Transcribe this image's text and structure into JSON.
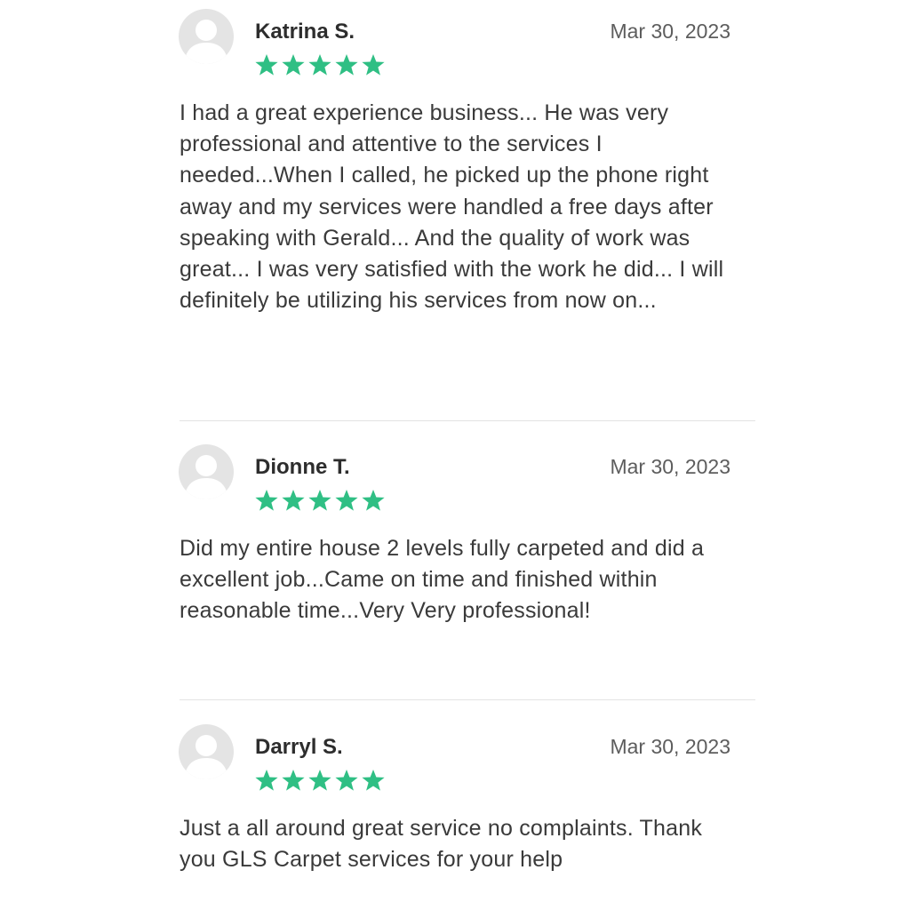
{
  "colors": {
    "star": "#2fbf84",
    "avatar_bg": "#e4e4e4",
    "avatar_fg": "#ffffff",
    "divider": "#e3e3e3"
  },
  "reviews": [
    {
      "name": "Katrina S.",
      "date": "Mar 30, 2023",
      "rating": 5,
      "avatar_icon": "person-placeholder-icon",
      "text": "I had a great experience business... He was very professional and attentive to the services I needed...When I called, he picked up the phone right away and my services were handled a free days after speaking with Gerald... And the quality of work was great... I was very satisfied with the work he did... I will definitely be utilizing his services from now on..."
    },
    {
      "name": "Dionne T.",
      "date": "Mar 30, 2023",
      "rating": 5,
      "avatar_icon": "person-placeholder-icon",
      "text": "Did my entire house 2 levels fully carpeted and did a excellent job...Came on time and finished within reasonable time...Very Very professional!"
    },
    {
      "name": "Darryl S.",
      "date": "Mar 30, 2023",
      "rating": 5,
      "avatar_icon": "person-placeholder-icon",
      "text": "Just a all around great service no complaints. Thank you GLS Carpet services for your help"
    }
  ]
}
